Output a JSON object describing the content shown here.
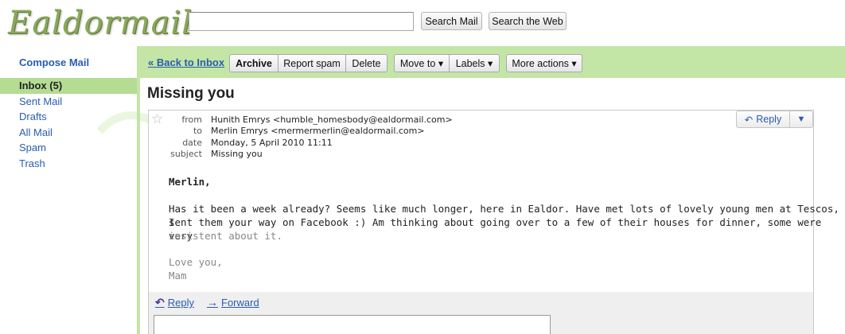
{
  "header": {
    "logo_text": "Ealdormail",
    "search_placeholder": "",
    "search_mail_label": "Search Mail",
    "search_web_label": "Search the Web"
  },
  "sidebar": {
    "compose_label": "Compose Mail",
    "items": [
      {
        "label": "Inbox (5)",
        "active": true
      },
      {
        "label": "Sent Mail"
      },
      {
        "label": "Drafts"
      },
      {
        "label": "All Mail"
      },
      {
        "label": "Spam"
      },
      {
        "label": "Trash"
      }
    ]
  },
  "toolbar": {
    "back_label": "« Back to Inbox",
    "archive_label": "Archive",
    "spam_label": "Report spam",
    "delete_label": "Delete",
    "move_label": "Move to ▾",
    "labels_label": "Labels ▾",
    "more_label": "More actions ▾"
  },
  "message": {
    "subject_title": "Missing you",
    "star_icon": "☆",
    "header_labels": {
      "from": "from",
      "to": "to",
      "date": "date",
      "subject": "subject"
    },
    "from": "Hunith Emrys <humble_homesbody@ealdormail.com>",
    "to": "Merlin Emrys <mermermerlin@ealdormail.com>",
    "date": "Monday, 5 April 2010 11:11",
    "subject": "Missing you",
    "reply_label": "Reply",
    "reply_menu_icon": "▼",
    "greeting": "Merlin,",
    "body_line1": "Has it been a week already? Seems like much longer, here in Ealdor. Have met lots of lovely young men at Tescos, I",
    "body_line2": "sent them your way on Facebook :) Am thinking about going over to a few of their houses for dinner, some were very",
    "body_line3": "insistent about it.",
    "signoff": "Love you,",
    "signature": "Mam"
  },
  "footer": {
    "reply_label": "Reply",
    "forward_label": "Forward",
    "reply_icon": "↶",
    "forward_icon": "→"
  },
  "colors": {
    "accent_green": "#c3e5a5",
    "link_blue": "#2a5db0",
    "active_nav": "#b5dc93"
  }
}
